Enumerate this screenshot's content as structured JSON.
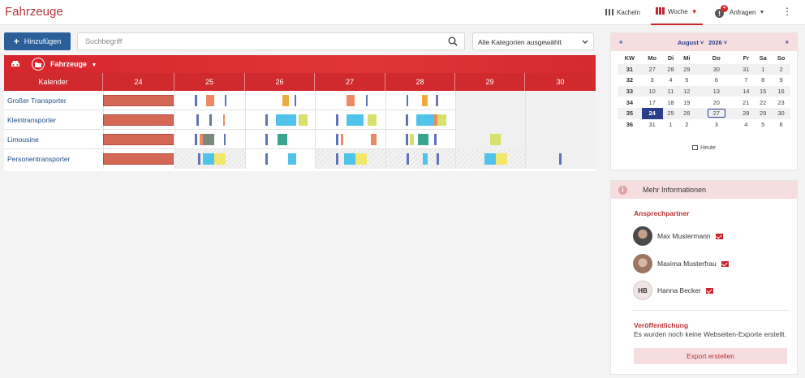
{
  "header": {
    "title": "Fahrzeuge",
    "views": [
      {
        "label": "Kacheln",
        "icon": "grid-icon"
      },
      {
        "label": "Woche",
        "icon": "week-columns-icon",
        "active": true
      },
      {
        "label": "Anfragen",
        "icon": "alert-circle-icon",
        "badge": "4"
      }
    ]
  },
  "toolbar": {
    "add_label": "Hinzufügen",
    "search_placeholder": "Suchbegriff",
    "category_select": "Alle Kategorien ausgewählt"
  },
  "grid": {
    "group_title": "Fahrzeuge",
    "calendar_label": "Kalender",
    "days": [
      "24",
      "25",
      "26",
      "27",
      "28",
      "29",
      "30"
    ],
    "vehicles": [
      "Großer Transporter",
      "Kleintransporter",
      "Limousine",
      "Personentransporter"
    ]
  },
  "calendar": {
    "month": "August",
    "year": "2026",
    "headers": [
      "KW",
      "Mo",
      "Di",
      "Mi",
      "Do",
      "Fr",
      "Sa",
      "So"
    ],
    "weeks": [
      [
        "31",
        "27",
        "28",
        "29",
        "30",
        "31",
        "1",
        "2"
      ],
      [
        "32",
        "3",
        "4",
        "5",
        "6",
        "7",
        "8",
        "9"
      ],
      [
        "33",
        "10",
        "11",
        "12",
        "13",
        "14",
        "15",
        "16"
      ],
      [
        "34",
        "17",
        "18",
        "19",
        "20",
        "21",
        "22",
        "23"
      ],
      [
        "35",
        "24",
        "25",
        "26",
        "27",
        "28",
        "29",
        "30"
      ],
      [
        "36",
        "31",
        "1",
        "2",
        "3",
        "4",
        "5",
        "6"
      ]
    ],
    "selected_day": "24",
    "today": "27",
    "today_button": "Heute"
  },
  "info": {
    "title": "Mehr Informationen",
    "contacts_title": "Ansprechpartner",
    "contacts": [
      {
        "name": "Max Mustermann",
        "initials": ""
      },
      {
        "name": "Maxima Musterfrau",
        "initials": ""
      },
      {
        "name": "Hanna Becker",
        "initials": "HB"
      }
    ],
    "publication_title": "Veröffentlichung",
    "publication_text": "Es wurden noch keine Webseiten-Exporte erstellt.",
    "export_button": "Export erstellen"
  },
  "colors": {
    "brand_red": "#c8252c",
    "header_red": "#d5262d",
    "navy": "#2a3e8c",
    "add_button": "#2a5f99"
  }
}
